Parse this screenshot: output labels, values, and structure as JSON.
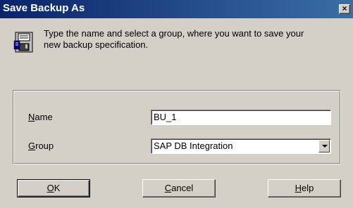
{
  "window": {
    "title": "Save Backup As",
    "close_glyph": "×"
  },
  "message": {
    "icon": "floppy-disk-icon",
    "line1": "Type the name and select a group, where you want to save your",
    "line2": "new backup specification."
  },
  "form": {
    "name_label_mnemonic": "N",
    "name_label_rest": "ame",
    "name_value": "BU_1",
    "group_label_mnemonic": "G",
    "group_label_rest": "roup",
    "group_value": "SAP DB Integration"
  },
  "buttons": {
    "ok_mnemonic": "O",
    "ok_rest": "K",
    "cancel_mnemonic": "C",
    "cancel_rest": "ancel",
    "help_mnemonic": "H",
    "help_rest": "elp"
  },
  "colors": {
    "titlebar": "#0a246a",
    "face": "#d4d0c8"
  }
}
